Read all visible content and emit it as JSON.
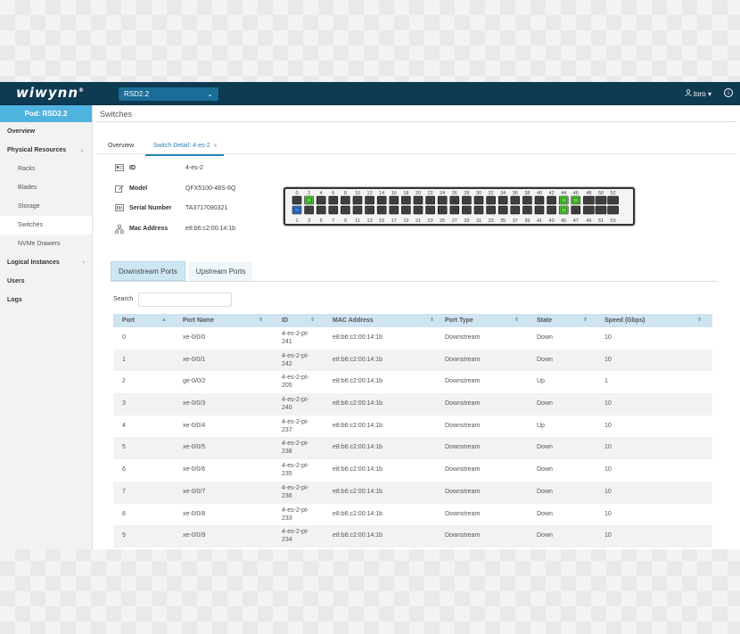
{
  "app": {
    "logo": "wiwynn",
    "logo_mark": "®",
    "rsd_selected": "RSD2.2",
    "user": "toro",
    "user_caret": "▾",
    "info_icon": "i"
  },
  "sidebar": {
    "pod": "Pod: RSD2.2",
    "items": [
      {
        "label": "Overview"
      },
      {
        "label": "Physical Resources",
        "arrow": "⌄"
      },
      {
        "label": "Racks"
      },
      {
        "label": "Blades"
      },
      {
        "label": "Storage"
      },
      {
        "label": "Switches"
      },
      {
        "label": "NVMe Drawers"
      },
      {
        "label": "Logical Instances",
        "arrow": "‹"
      },
      {
        "label": "Users"
      },
      {
        "label": "Logs"
      }
    ]
  },
  "main": {
    "title": "Switches",
    "tabs": [
      {
        "label": "Overview"
      },
      {
        "label": "Switch Detail: 4-es-2",
        "close": "x"
      }
    ],
    "details": {
      "id": {
        "label": "ID",
        "value": "4-es-2"
      },
      "model": {
        "label": "Model",
        "value": "QFX5100-48S-6Q"
      },
      "serial": {
        "label": "Serial Number",
        "value": "TA3717090321"
      },
      "mac": {
        "label": "Mac Address",
        "value": "e8:b6:c2:00:14:1b"
      }
    },
    "port_tabs": {
      "downstream": "Downstream Ports",
      "upstream": "Upstream Ports"
    },
    "search": {
      "label": "Search",
      "placeholder": ""
    }
  },
  "switch_panel": {
    "top_labels": [
      "0",
      "2",
      "4",
      "6",
      "8",
      "10",
      "12",
      "14",
      "16",
      "18",
      "20",
      "22",
      "24",
      "26",
      "28",
      "30",
      "32",
      "34",
      "36",
      "38",
      "40",
      "42",
      "44",
      "46",
      "48",
      "50",
      "52"
    ],
    "bottom_labels": [
      "1",
      "3",
      "5",
      "7",
      "9",
      "11",
      "13",
      "15",
      "17",
      "19",
      "21",
      "23",
      "25",
      "27",
      "29",
      "31",
      "33",
      "35",
      "37",
      "39",
      "41",
      "43",
      "45",
      "47",
      "49",
      "51",
      "53"
    ],
    "port_states": {
      "1": "active-blue",
      "2": "up-green",
      "44": "up-green",
      "45": "up-green",
      "46": "up-green"
    },
    "colors": {
      "port": "#3a3a3a",
      "blue": "#2f7fd8",
      "green": "#56d33a"
    }
  },
  "table": {
    "columns": [
      "Port",
      "Port Name",
      "ID",
      "MAC Address",
      "Port Type",
      "State",
      "Speed (Gbps)"
    ],
    "rows": [
      {
        "port": "0",
        "name": "xe-0/0/0",
        "id1": "4-es-2-pt-",
        "id2": "241",
        "mac": "e8:b6:c2:00:14:1b",
        "type": "Downstream",
        "state": "Down",
        "speed": "10"
      },
      {
        "port": "1",
        "name": "xe-0/0/1",
        "id1": "4-es-2-pt-",
        "id2": "242",
        "mac": "e8:b6:c2:00:14:1b",
        "type": "Downstream",
        "state": "Down",
        "speed": "10"
      },
      {
        "port": "2",
        "name": "ge-0/0/2",
        "id1": "4-es-2-pt-",
        "id2": "205",
        "mac": "e8:b6:c2:00:14:1b",
        "type": "Downstream",
        "state": "Up",
        "speed": "1"
      },
      {
        "port": "3",
        "name": "xe-0/0/3",
        "id1": "4-es-2-pt-",
        "id2": "240",
        "mac": "e8:b6:c2:00:14:1b",
        "type": "Downstream",
        "state": "Down",
        "speed": "10"
      },
      {
        "port": "4",
        "name": "xe-0/0/4",
        "id1": "4-es-2-pt-",
        "id2": "237",
        "mac": "e8:b6:c2:00:14:1b",
        "type": "Downstream",
        "state": "Up",
        "speed": "10"
      },
      {
        "port": "5",
        "name": "xe-0/0/5",
        "id1": "4-es-2-pt-",
        "id2": "238",
        "mac": "e8:b6:c2:00:14:1b",
        "type": "Downstream",
        "state": "Down",
        "speed": "10"
      },
      {
        "port": "6",
        "name": "xe-0/0/6",
        "id1": "4-es-2-pt-",
        "id2": "235",
        "mac": "e8:b6:c2:00:14:1b",
        "type": "Downstream",
        "state": "Down",
        "speed": "10"
      },
      {
        "port": "7",
        "name": "xe-0/0/7",
        "id1": "4-es-2-pt-",
        "id2": "236",
        "mac": "e8:b6:c2:00:14:1b",
        "type": "Downstream",
        "state": "Down",
        "speed": "10"
      },
      {
        "port": "8",
        "name": "xe-0/0/8",
        "id1": "4-es-2-pt-",
        "id2": "233",
        "mac": "e8:b6:c2:00:14:1b",
        "type": "Downstream",
        "state": "Down",
        "speed": "10"
      },
      {
        "port": "9",
        "name": "xe-0/0/9",
        "id1": "4-es-2-pt-",
        "id2": "234",
        "mac": "e8:b6:c2:00:14:1b",
        "type": "Downstream",
        "state": "Down",
        "speed": "10"
      }
    ]
  }
}
